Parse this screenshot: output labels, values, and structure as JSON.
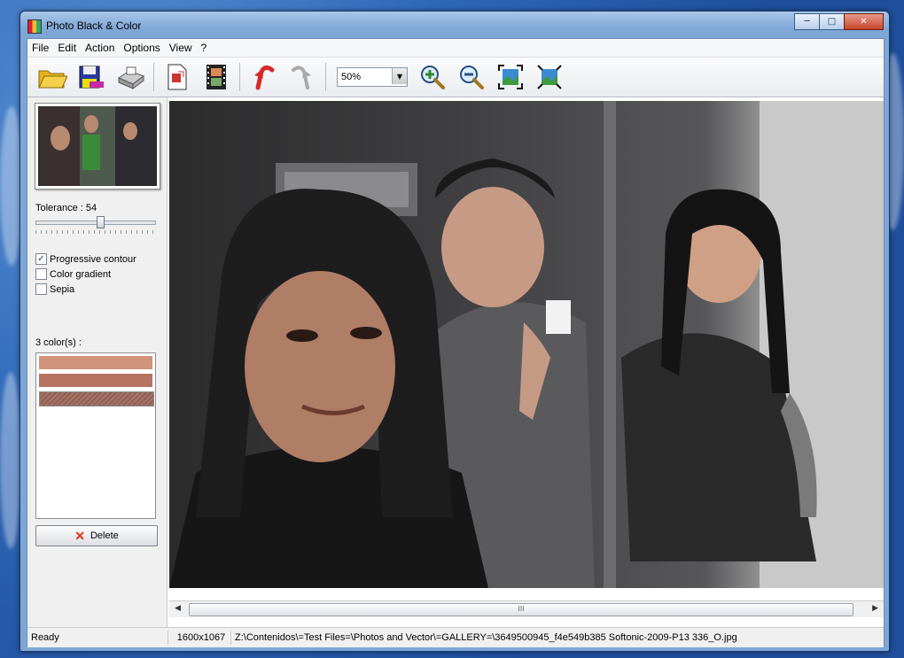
{
  "window": {
    "title": "Photo Black & Color",
    "controls": [
      "minimize-icon",
      "maximize-icon",
      "close-icon"
    ]
  },
  "menu": {
    "items": [
      "File",
      "Edit",
      "Action",
      "Options",
      "View",
      "?"
    ]
  },
  "toolbar": {
    "buttons": [
      "open-folder-icon",
      "save-icon",
      "print-icon",
      "image-export-icon",
      "filmstrip-icon",
      "undo-icon",
      "redo-icon"
    ],
    "zoom_value": "50%",
    "after_zoom": [
      "zoom-in-icon",
      "zoom-out-icon",
      "fit-to-window-icon",
      "actual-size-icon"
    ]
  },
  "sidebar": {
    "tolerance_label": "Tolerance : 54",
    "tolerance_value": 54,
    "options": [
      {
        "label": "Progressive contour",
        "checked": true
      },
      {
        "label": "Color gradient",
        "checked": false
      },
      {
        "label": "Sepia",
        "checked": false
      }
    ],
    "colors_label": "3 color(s) :",
    "swatches": [
      "#cf9479",
      "#b67362",
      "#a77366"
    ],
    "delete_label": "Delete"
  },
  "status": {
    "state": "Ready",
    "dimensions": "1600x1067",
    "path": "Z:\\Contenidos\\=Test Files=\\Photos and Vector\\=GALLERY=\\3649500945_f4e549b385 Softonic-2009-P13 336_O.jpg"
  },
  "scroll": {
    "grip": "III"
  }
}
